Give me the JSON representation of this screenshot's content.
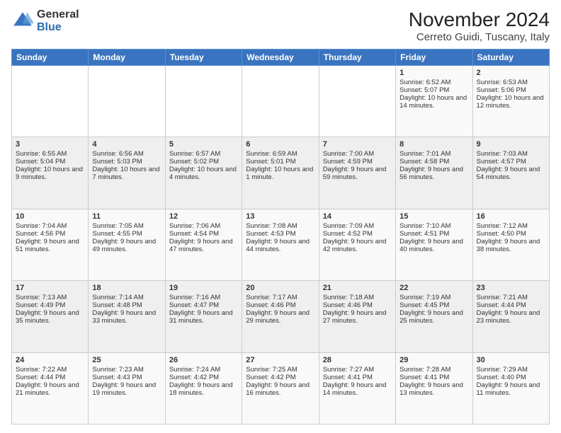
{
  "logo": {
    "line1": "General",
    "line2": "Blue"
  },
  "title": "November 2024",
  "subtitle": "Cerreto Guidi, Tuscany, Italy",
  "weekdays": [
    "Sunday",
    "Monday",
    "Tuesday",
    "Wednesday",
    "Thursday",
    "Friday",
    "Saturday"
  ],
  "rows": [
    [
      {
        "day": "",
        "info": ""
      },
      {
        "day": "",
        "info": ""
      },
      {
        "day": "",
        "info": ""
      },
      {
        "day": "",
        "info": ""
      },
      {
        "day": "",
        "info": ""
      },
      {
        "day": "1",
        "info": "Sunrise: 6:52 AM\nSunset: 5:07 PM\nDaylight: 10 hours and 14 minutes."
      },
      {
        "day": "2",
        "info": "Sunrise: 6:53 AM\nSunset: 5:06 PM\nDaylight: 10 hours and 12 minutes."
      }
    ],
    [
      {
        "day": "3",
        "info": "Sunrise: 6:55 AM\nSunset: 5:04 PM\nDaylight: 10 hours and 9 minutes."
      },
      {
        "day": "4",
        "info": "Sunrise: 6:56 AM\nSunset: 5:03 PM\nDaylight: 10 hours and 7 minutes."
      },
      {
        "day": "5",
        "info": "Sunrise: 6:57 AM\nSunset: 5:02 PM\nDaylight: 10 hours and 4 minutes."
      },
      {
        "day": "6",
        "info": "Sunrise: 6:59 AM\nSunset: 5:01 PM\nDaylight: 10 hours and 1 minute."
      },
      {
        "day": "7",
        "info": "Sunrise: 7:00 AM\nSunset: 4:59 PM\nDaylight: 9 hours and 59 minutes."
      },
      {
        "day": "8",
        "info": "Sunrise: 7:01 AM\nSunset: 4:58 PM\nDaylight: 9 hours and 56 minutes."
      },
      {
        "day": "9",
        "info": "Sunrise: 7:03 AM\nSunset: 4:57 PM\nDaylight: 9 hours and 54 minutes."
      }
    ],
    [
      {
        "day": "10",
        "info": "Sunrise: 7:04 AM\nSunset: 4:56 PM\nDaylight: 9 hours and 51 minutes."
      },
      {
        "day": "11",
        "info": "Sunrise: 7:05 AM\nSunset: 4:55 PM\nDaylight: 9 hours and 49 minutes."
      },
      {
        "day": "12",
        "info": "Sunrise: 7:06 AM\nSunset: 4:54 PM\nDaylight: 9 hours and 47 minutes."
      },
      {
        "day": "13",
        "info": "Sunrise: 7:08 AM\nSunset: 4:53 PM\nDaylight: 9 hours and 44 minutes."
      },
      {
        "day": "14",
        "info": "Sunrise: 7:09 AM\nSunset: 4:52 PM\nDaylight: 9 hours and 42 minutes."
      },
      {
        "day": "15",
        "info": "Sunrise: 7:10 AM\nSunset: 4:51 PM\nDaylight: 9 hours and 40 minutes."
      },
      {
        "day": "16",
        "info": "Sunrise: 7:12 AM\nSunset: 4:50 PM\nDaylight: 9 hours and 38 minutes."
      }
    ],
    [
      {
        "day": "17",
        "info": "Sunrise: 7:13 AM\nSunset: 4:49 PM\nDaylight: 9 hours and 35 minutes."
      },
      {
        "day": "18",
        "info": "Sunrise: 7:14 AM\nSunset: 4:48 PM\nDaylight: 9 hours and 33 minutes."
      },
      {
        "day": "19",
        "info": "Sunrise: 7:16 AM\nSunset: 4:47 PM\nDaylight: 9 hours and 31 minutes."
      },
      {
        "day": "20",
        "info": "Sunrise: 7:17 AM\nSunset: 4:46 PM\nDaylight: 9 hours and 29 minutes."
      },
      {
        "day": "21",
        "info": "Sunrise: 7:18 AM\nSunset: 4:46 PM\nDaylight: 9 hours and 27 minutes."
      },
      {
        "day": "22",
        "info": "Sunrise: 7:19 AM\nSunset: 4:45 PM\nDaylight: 9 hours and 25 minutes."
      },
      {
        "day": "23",
        "info": "Sunrise: 7:21 AM\nSunset: 4:44 PM\nDaylight: 9 hours and 23 minutes."
      }
    ],
    [
      {
        "day": "24",
        "info": "Sunrise: 7:22 AM\nSunset: 4:44 PM\nDaylight: 9 hours and 21 minutes."
      },
      {
        "day": "25",
        "info": "Sunrise: 7:23 AM\nSunset: 4:43 PM\nDaylight: 9 hours and 19 minutes."
      },
      {
        "day": "26",
        "info": "Sunrise: 7:24 AM\nSunset: 4:42 PM\nDaylight: 9 hours and 18 minutes."
      },
      {
        "day": "27",
        "info": "Sunrise: 7:25 AM\nSunset: 4:42 PM\nDaylight: 9 hours and 16 minutes."
      },
      {
        "day": "28",
        "info": "Sunrise: 7:27 AM\nSunset: 4:41 PM\nDaylight: 9 hours and 14 minutes."
      },
      {
        "day": "29",
        "info": "Sunrise: 7:28 AM\nSunset: 4:41 PM\nDaylight: 9 hours and 13 minutes."
      },
      {
        "day": "30",
        "info": "Sunrise: 7:29 AM\nSunset: 4:40 PM\nDaylight: 9 hours and 11 minutes."
      }
    ]
  ]
}
